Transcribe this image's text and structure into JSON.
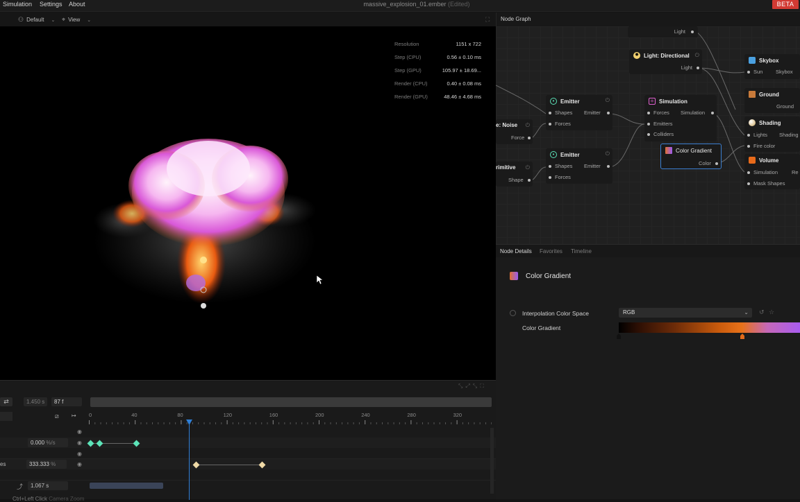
{
  "menu": [
    "Simulation",
    "Settings",
    "About"
  ],
  "window_title": "massive_explosion_01.ember",
  "window_title_status": "(Edited)",
  "beta_badge": "BETA",
  "viewport_toolbar": {
    "layout": "Default",
    "view": "View"
  },
  "stats": [
    {
      "label": "Resolution",
      "value": "1151 x 722"
    },
    {
      "label": "Step (CPU)",
      "value": "0.56 ± 0.10 ms"
    },
    {
      "label": "Step (GPU)",
      "value": "105.97 ± 18.69..."
    },
    {
      "label": "Render (CPU)",
      "value": "0.40 ± 0.08 ms"
    },
    {
      "label": "Render (GPU)",
      "value": "48.46 ± 4.68 ms"
    }
  ],
  "timeline": {
    "time_value": "1.450 s",
    "frame_value": "87 f",
    "ruler": [
      "0",
      "40",
      "80",
      "120",
      "160",
      "200",
      "240",
      "280",
      "320"
    ],
    "track1_value": "0.000",
    "track1_unit": "%/s",
    "track2_label": "es",
    "track2_value": "333.333",
    "track2_unit": "%",
    "duration_value": "1.067 s",
    "hint": "Ctrl+Left Click",
    "hint2": "Camera Zoom"
  },
  "node_graph": {
    "title": "Node Graph",
    "nodes": {
      "light_top": {
        "port": "Light"
      },
      "light_directional": {
        "title": "Light: Directional",
        "port": "Light"
      },
      "skybox": {
        "title": "Skybox",
        "in": "Sun",
        "out": "Skybox"
      },
      "ground": {
        "title": "Ground",
        "out": "Ground"
      },
      "emitter1": {
        "title": "Emitter",
        "in1": "Shapes",
        "in2": "Forces",
        "out": "Emitter"
      },
      "noise": {
        "title": "e: Noise",
        "out": "Force"
      },
      "simulation": {
        "title": "Simulation",
        "in1": "Forces",
        "in2": "Emitters",
        "in3": "Colliders",
        "out": "Simulation"
      },
      "color_gradient": {
        "title": "Color Gradient",
        "out": "Color"
      },
      "shading": {
        "title": "Shading",
        "in1": "Lights",
        "in2": "Fire color",
        "out": "Shading"
      },
      "emitter2": {
        "title": "Emitter",
        "in1": "Shapes",
        "in2": "Forces",
        "out": "Emitter"
      },
      "primitive": {
        "title": "rimitive",
        "out": "Shape"
      },
      "volume": {
        "title": "Volume",
        "in1": "Simulation",
        "in2": "Mask Shapes",
        "out": "Re"
      }
    }
  },
  "details": {
    "tabs": [
      "Node Details",
      "Favorites",
      "Timeline"
    ],
    "node_title": "Color Gradient",
    "prop1_label": "Interpolation Color Space",
    "prop1_value": "RGB",
    "prop2_label": "Color Gradient"
  },
  "colors": {
    "accent": "#3b7fd1",
    "beta": "#d23a33",
    "keyframe_teal": "#5ce3b8",
    "keyframe_cream": "#efd9a6",
    "playhead": "#2f7fd6"
  }
}
